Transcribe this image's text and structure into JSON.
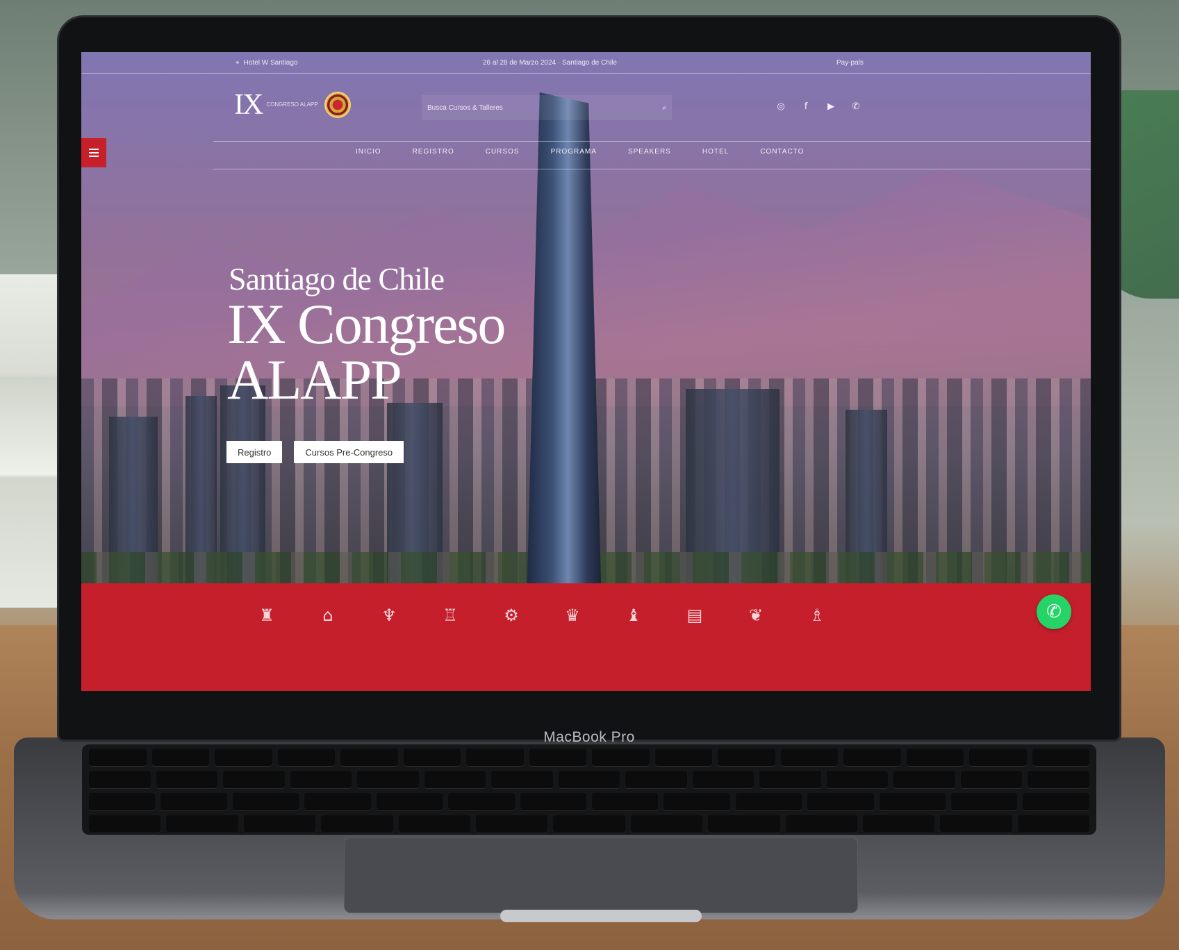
{
  "device": {
    "brand": "MacBook Pro"
  },
  "topbar": {
    "location_icon": "map-pin-icon",
    "location": "Hotel W Santiago",
    "dates": "26 al 28 de Marzo 2024 · Santiago de Chile",
    "pay": "Pay-pals"
  },
  "header": {
    "logo_mark": "IX",
    "logo_text": "CONGRESO ALAPP",
    "search_placeholder": "Busca Cursos & Talleres",
    "search_icon": "search-icon",
    "socials": [
      {
        "name": "instagram-icon",
        "glyph": "◎"
      },
      {
        "name": "facebook-icon",
        "glyph": "f"
      },
      {
        "name": "youtube-icon",
        "glyph": "▶"
      },
      {
        "name": "whatsapp-small-icon",
        "glyph": "✆"
      }
    ]
  },
  "nav": [
    "Inicio",
    "Registro",
    "Cursos",
    "Programa",
    "Speakers",
    "Hotel",
    "Contacto"
  ],
  "hero": {
    "subtitle": "Santiago de Chile",
    "title_line1": "IX Congreso",
    "title_line2": "ALAPP",
    "buttons": [
      "Registro",
      "Cursos Pre-Congreso"
    ]
  },
  "band": {
    "color": "#c61f2c",
    "icons": [
      {
        "name": "moai-icon",
        "glyph": "♜"
      },
      {
        "name": "church-icon",
        "glyph": "⌂"
      },
      {
        "name": "condor-icon",
        "glyph": "♆"
      },
      {
        "name": "drink-icon",
        "glyph": "♖"
      },
      {
        "name": "wheel-icon",
        "glyph": "⚙"
      },
      {
        "name": "dancer-icon",
        "glyph": "♛"
      },
      {
        "name": "tower-icon",
        "glyph": "♝"
      },
      {
        "name": "book-icon",
        "glyph": "▤"
      },
      {
        "name": "copihue-icon",
        "glyph": "❦"
      },
      {
        "name": "wine-bottle-icon",
        "glyph": "♗"
      }
    ],
    "whatsapp_icon": "whatsapp-icon"
  }
}
